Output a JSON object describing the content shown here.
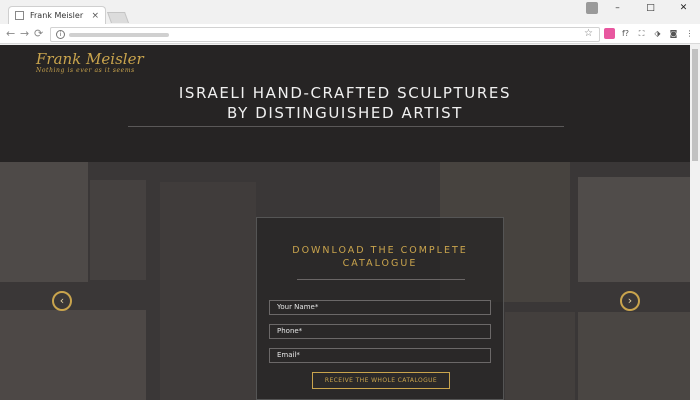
{
  "browser": {
    "tab_title": "Frank Meisler",
    "tab_close": "×",
    "window_controls": [
      "–",
      "□",
      "✕"
    ],
    "nav": {
      "back": "←",
      "forward": "→",
      "reload": "⟳"
    },
    "omnibox_star": "☆",
    "extensions": [
      {
        "icon": "pink-square-icon",
        "glyph": "",
        "color": "#e8579f"
      },
      {
        "icon": "font-f-icon",
        "glyph": "f?",
        "color": "#ffffff"
      },
      {
        "icon": "crop-icon",
        "glyph": "⛶",
        "color": "#ffffff"
      },
      {
        "icon": "tag-icon",
        "glyph": "⬗",
        "color": "#ffffff"
      },
      {
        "icon": "camera-icon",
        "glyph": "◙",
        "color": "#ffffff"
      },
      {
        "icon": "menu-icon",
        "glyph": "⋮",
        "color": "#ffffff"
      }
    ]
  },
  "site": {
    "logo": "Frank Meisler",
    "tagline": "Nothing is ever as it seems",
    "headline_line1": "ISRAELI HAND-CRAFTED SCULPTURES",
    "headline_line2": "BY DISTINGUISHED ARTIST",
    "accent": "#c9a44d"
  },
  "gallery": {
    "prev_arrow": "‹",
    "next_arrow": "›"
  },
  "form": {
    "title_line1": "DOWNLOAD THE COMPLETE",
    "title_line2": "CATALOGUE",
    "name_placeholder": "Your Name*",
    "phone_placeholder": "Phone*",
    "email_placeholder": "Email*",
    "submit_label": "RECEIVE THE WHOLE CATALOGUE"
  }
}
